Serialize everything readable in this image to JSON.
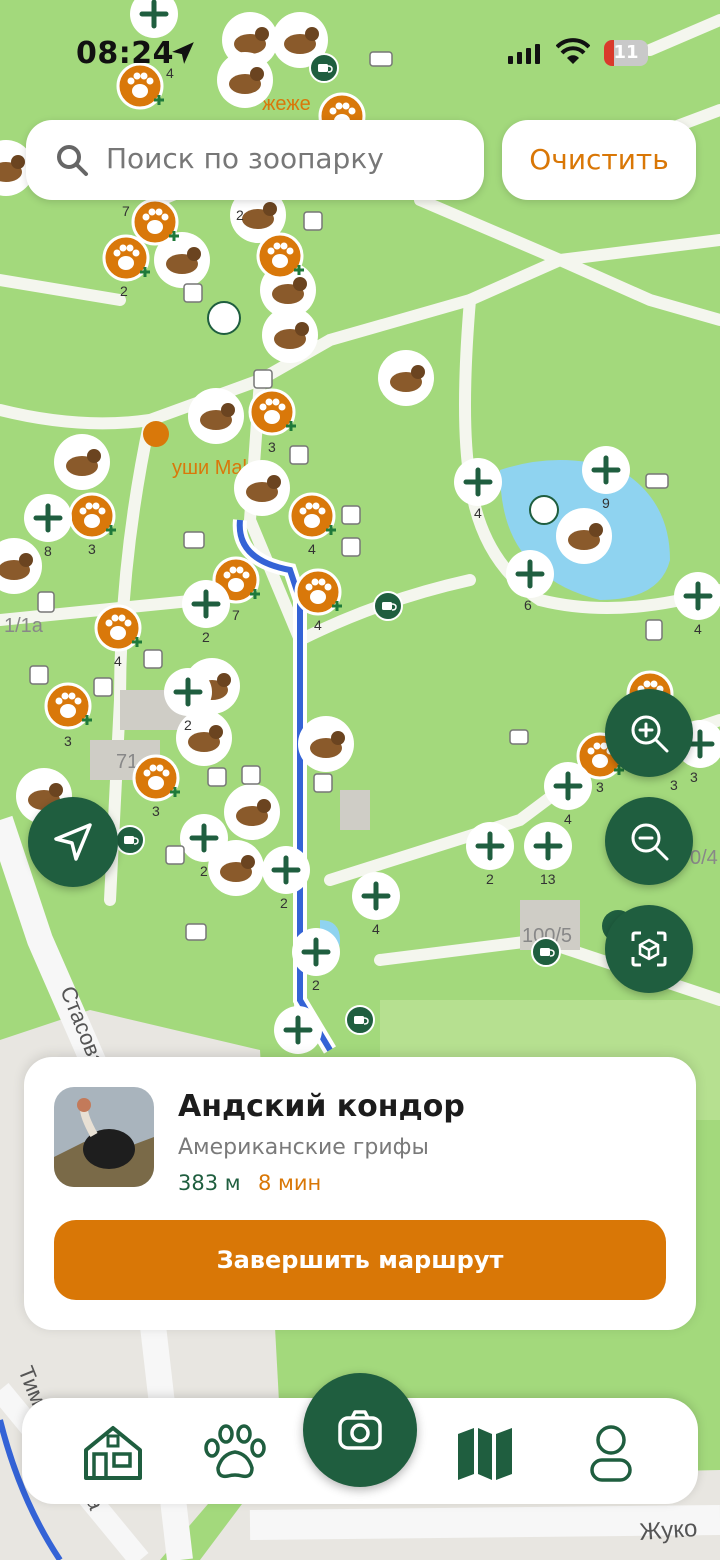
{
  "status_bar": {
    "time": "08:24",
    "battery": "11"
  },
  "search": {
    "placeholder": "Поиск по зоопарку",
    "clear_label": "Очистить"
  },
  "map": {
    "labels": {
      "sushi": "уши Make",
      "street_1": "Стасова",
      "street_2": "Тим",
      "street_3": "Жуко",
      "street_4": "а",
      "building_1": "71",
      "building_2": "1/1а",
      "building_3": "100/5",
      "building_4": "0/4",
      "top_label": "жеже"
    },
    "cluster_counts": [
      "4",
      "7",
      "2",
      "3",
      "3",
      "4",
      "4",
      "7",
      "2",
      "4",
      "3",
      "2",
      "3",
      "2",
      "2",
      "2",
      "4",
      "2",
      "4",
      "6",
      "9",
      "4",
      "3",
      "4",
      "3",
      "13",
      "3",
      "8",
      "2"
    ]
  },
  "route_card": {
    "title": "Андский кондор",
    "subtitle": "Американские грифы",
    "distance": "383 м",
    "duration": "8 мин",
    "finish_label": "Завершить маршрут"
  },
  "nav": {
    "items": [
      {
        "icon": "home-icon"
      },
      {
        "icon": "paw-icon"
      },
      {
        "icon": "camera-icon"
      },
      {
        "icon": "map-icon"
      },
      {
        "icon": "profile-icon"
      }
    ]
  },
  "colors": {
    "primary_green": "#1f5e3f",
    "accent_orange": "#d97706",
    "map_green": "#9fd77a",
    "path": "#ffffff"
  }
}
